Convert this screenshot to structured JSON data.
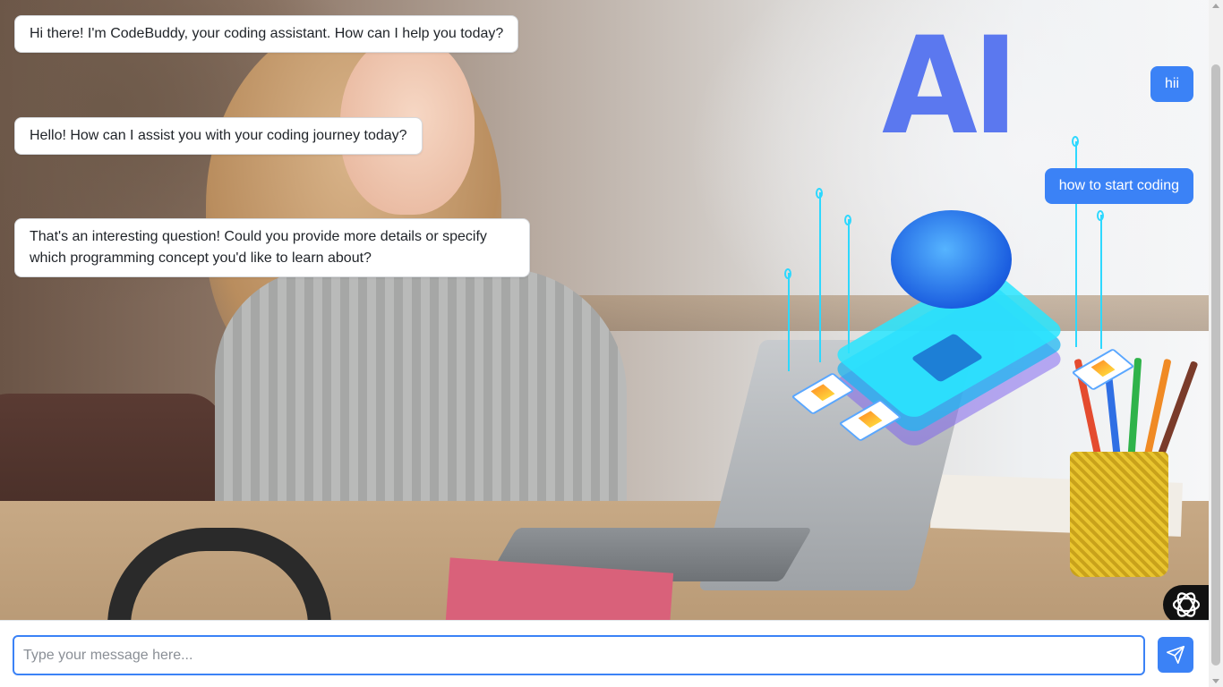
{
  "background": {
    "title_text": "AI",
    "accent_color": "#5b78ef"
  },
  "messages": [
    {
      "role": "bot",
      "text": "Hi there! I'm CodeBuddy, your coding assistant. How can I help you today?"
    },
    {
      "role": "user",
      "text": "hii"
    },
    {
      "role": "bot",
      "text": "Hello! How can I assist you with your coding journey today?"
    },
    {
      "role": "user",
      "text": "how to start coding"
    },
    {
      "role": "bot",
      "text": "That's an interesting question! Could you provide more details or specify which programming concept you'd like to learn about?"
    }
  ],
  "composer": {
    "placeholder": "Type your message here...",
    "value": "",
    "send_icon": "send-icon"
  },
  "assistant_logo_icon": "openai-logo-icon",
  "colors": {
    "user_bubble": "#3b82f6",
    "bot_bubble": "#ffffff",
    "send_button": "#3b82f6"
  }
}
